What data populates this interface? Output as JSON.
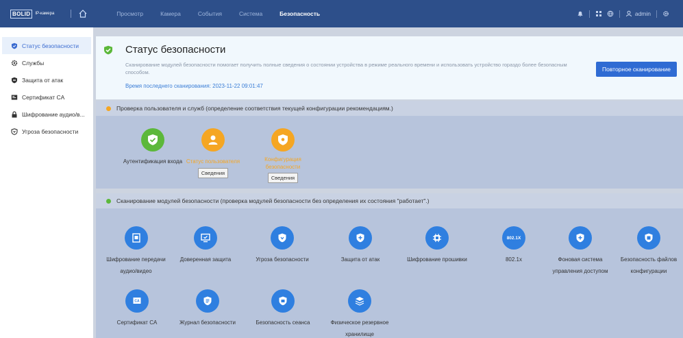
{
  "topbar": {
    "brand": "BOLID",
    "brand_sub": "IP-камера",
    "nav": [
      "Просмотр",
      "Камера",
      "События",
      "Система",
      "Безопасность"
    ],
    "active_nav": "Безопасность",
    "user": "admin"
  },
  "sidebar": {
    "items": [
      {
        "label": "Статус безопасности",
        "icon": "shield-icon"
      },
      {
        "label": "Службы",
        "icon": "gear-icon"
      },
      {
        "label": "Защита от атак",
        "icon": "shield-icon"
      },
      {
        "label": "Сертификат CA",
        "icon": "certificate-icon"
      },
      {
        "label": "Шифрование аудио/в...",
        "icon": "lock-icon"
      },
      {
        "label": "Угроза безопасности",
        "icon": "shield-icon"
      }
    ]
  },
  "status": {
    "title": "Статус безопасности",
    "description": "Сканирование модулей безопасности помогает получить полные сведения о состоянии устройства в режиме реального времени и использовать устройство гораздо более безопасным способом.",
    "last_scan_label": "Время последнего сканирования:",
    "last_scan_time": "2023-11-22 09:01:47",
    "rescan_button": "Повторное сканирование"
  },
  "user_check": {
    "heading": "Проверка пользователя и служб (определение соответствия текущей конфигурации рекомендациям.)",
    "items": [
      {
        "label": "Аутентификация входа",
        "status": "ok"
      },
      {
        "label": "Статус пользователя",
        "status": "warning",
        "details": "Сведения"
      },
      {
        "label": "Конфигурация безопасности",
        "status": "warning",
        "details": "Сведения"
      }
    ]
  },
  "module_scan": {
    "heading": "Сканирование модулей безопасности (проверка модулей безопасности без определения их состояния \"работает\".)",
    "items": [
      {
        "label": "Шифрование передачи аудио/видео",
        "icon": "video-encryption-icon"
      },
      {
        "label": "Доверенная защита",
        "icon": "trusted-monitor-icon"
      },
      {
        "label": "Угроза безопасности",
        "icon": "shield-threat-icon"
      },
      {
        "label": "Защита от атак",
        "icon": "shield-plus-icon"
      },
      {
        "label": "Шифрование прошивки",
        "icon": "chip-icon"
      },
      {
        "label": "802.1x",
        "icon": "badge-8021x-icon",
        "icon_text": "802.1X"
      },
      {
        "label": "Фоновая система управления доступом",
        "icon": "shield-plus-icon"
      },
      {
        "label": "Безопасность файлов конфигурации",
        "icon": "config-file-icon"
      },
      {
        "label": "Сертификат CA",
        "icon": "ca-certificate-icon",
        "icon_text": "CA"
      },
      {
        "label": "Журнал безопасности",
        "icon": "log-icon"
      },
      {
        "label": "Безопасность сеанса",
        "icon": "session-icon"
      },
      {
        "label": "Физическое резервное хранилище",
        "icon": "layers-icon"
      }
    ]
  },
  "colors": {
    "ok": "#5cb83a",
    "warning": "#f5a623",
    "module": "#2f7fe0",
    "topbar": "#2d4f8a"
  }
}
